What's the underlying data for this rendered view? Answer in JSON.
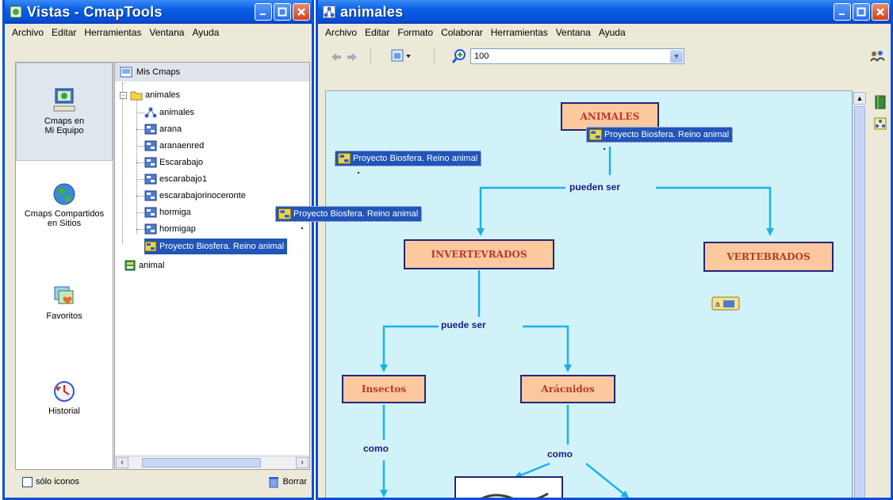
{
  "left_window": {
    "title": "Vistas - CmapTools",
    "menu": [
      "Archivo",
      "Editar",
      "Herramientas",
      "Ventana",
      "Ayuda"
    ],
    "views": [
      {
        "label_line1": "Cmaps en",
        "label_line2": "Mi Equipo"
      },
      {
        "label_line1": "Cmaps Compartidos",
        "label_line2": "en Sitios"
      },
      {
        "label_line1": "Favoritos",
        "label_line2": ""
      },
      {
        "label_line1": "Historial",
        "label_line2": ""
      }
    ],
    "tree": {
      "root": "Mis Cmaps",
      "folder": "animales",
      "items": [
        "animales",
        "arana",
        "aranaenred",
        "Escarabajo",
        "escarabajo1",
        "escarabajorinoceronte",
        "hormiga",
        "hormigap",
        "Proyecto Biosfera. Reino animal"
      ],
      "sibling": "animal"
    },
    "only_icons_label": "sólo iconos",
    "delete_label": "Borrar"
  },
  "right_window": {
    "title": "animales",
    "menu": [
      "Archivo",
      "Editar",
      "Formato",
      "Colaborar",
      "Herramientas",
      "Ventana",
      "Ayuda"
    ],
    "zoom": "100",
    "map": {
      "concepts": {
        "animales": "ANIMALES",
        "invertebrados": "INVERTEVRADOS",
        "vertebrados": "VERTEBRADOS",
        "insectos": "Insectos",
        "aracnidos": "Arácnidos"
      },
      "links": {
        "pueden_ser": "pueden ser",
        "puede_ser": "puede ser",
        "como_1": "como",
        "como_2": "como"
      }
    }
  },
  "drag_label": "Proyecto Biosfera. Reino animal",
  "colors": {
    "canvas": "#d2f2f9",
    "concept_fill": "#fcc99e",
    "concept_border": "#24247a",
    "concept_text": "#b8392b",
    "arrow": "#1ab2ee",
    "selection": "#2155b8",
    "titlebar": "#0a5ee5"
  }
}
